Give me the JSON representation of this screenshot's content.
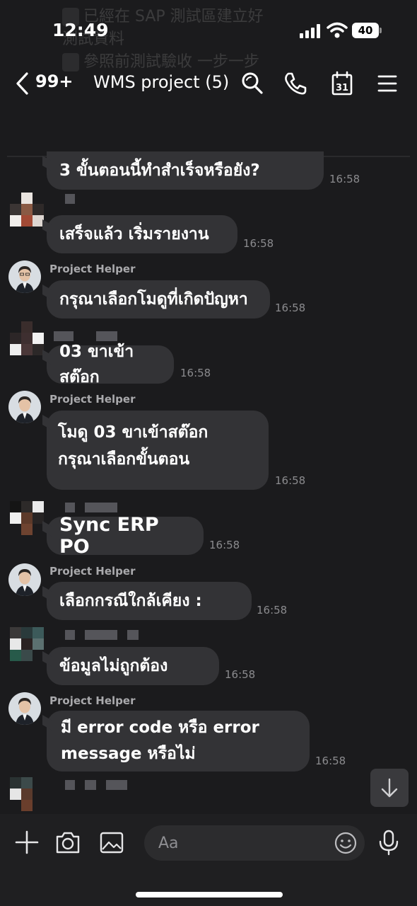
{
  "status_bar": {
    "time": "12:49",
    "battery": "40"
  },
  "pinned_ghost": {
    "lines": [
      "已經在 SAP 測試區建立好",
      "測試資料",
      "參照前測試驗收 一步一步"
    ]
  },
  "header": {
    "unread_count": "99+",
    "title": "WMS project (5)"
  },
  "messages": [
    {
      "sender": "",
      "text": "3 ขั้นตอนนี้ทำสำเร็จหรือยัง?",
      "time": "16:58"
    },
    {
      "sender": "",
      "text": "เสร็จแล้ว เริ่มรายงาน",
      "time": "16:58"
    },
    {
      "sender": "Project Helper",
      "text": "กรุณาเลือกโมดูที่เกิดปัญหา",
      "time": "16:58"
    },
    {
      "sender": "",
      "text": "03 ขาเข้าสต๊อก",
      "time": "16:58"
    },
    {
      "sender": "Project Helper",
      "lines": [
        "โมดู 03 ขาเข้าสต๊อก",
        "กรุณาเลือกขั้นตอน"
      ],
      "time": "16:58"
    },
    {
      "sender": "",
      "text": "Sync ERP PO",
      "time": "16:58"
    },
    {
      "sender": "Project Helper",
      "text": "เลือกกรณีใกล้เคียง  :",
      "time": "16:58"
    },
    {
      "sender": "",
      "text": "ข้อมูลไม่ถูกต้อง",
      "time": "16:58"
    },
    {
      "sender": "Project Helper",
      "lines": [
        "มี error code หรือ error",
        "message หรือไม่"
      ],
      "time": "16:58"
    }
  ],
  "input": {
    "placeholder": "Aa"
  },
  "icons": {
    "back": "chevron-left-icon",
    "search": "search-icon",
    "call": "phone-icon",
    "calendar": "calendar-icon",
    "calendar_day": "31",
    "menu": "menu-icon",
    "add": "plus-icon",
    "camera": "camera-icon",
    "image": "image-icon",
    "emoji": "emoji-icon",
    "mic": "microphone-icon",
    "scroll": "arrow-down-icon"
  },
  "colors": {
    "background": "#1b1b1d",
    "bubble": "#333336",
    "timestamp": "#8b8b8e",
    "sender": "#a9a9ac"
  }
}
